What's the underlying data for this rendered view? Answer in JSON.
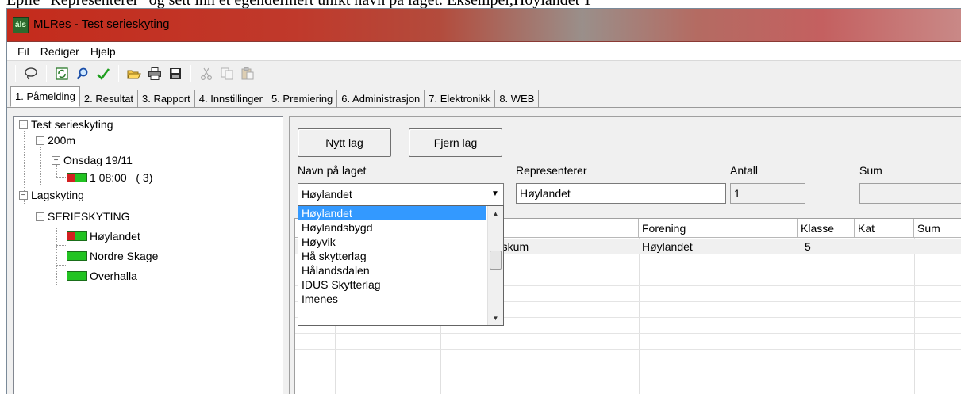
{
  "background_text": "Epile \"Representerer\" og sett inn et egendefinert unikt navn på laget. Eksempel,Hoylandet 1",
  "window": {
    "icon_text": "áls",
    "title": "MLRes - Test serieskyting"
  },
  "menu": [
    "Fil",
    "Rediger",
    "Hjelp"
  ],
  "toolbar": {
    "buttons": [
      "lasso-icon",
      "refresh-icon",
      "search-icon",
      "checkmark-icon",
      "open-folder-icon",
      "print-icon",
      "save-icon",
      "cut-icon",
      "copy-icon",
      "paste-icon"
    ]
  },
  "tabs": [
    "1. Påmelding",
    "2. Resultat",
    "3. Rapport",
    "4. Innstillinger",
    "5. Premiering",
    "6. Administrasjon",
    "7. Elektronikk",
    "8. WEB"
  ],
  "tree": {
    "root": "Test serieskyting",
    "distance": "200m",
    "day": "Onsdag 19/11",
    "relay": "1 08:00   ( 3)",
    "group": "Lagskyting",
    "series": "SERIESKYTING",
    "teams": [
      "Høylandet",
      "Nordre Skage",
      "Overhalla"
    ]
  },
  "panel": {
    "new_team_button": "Nytt lag",
    "remove_team_button": "Fjern lag",
    "team_name_label": "Navn på laget",
    "represents_label": "Representerer",
    "count_label": "Antall",
    "sum_label": "Sum",
    "team_name_value": "Høylandet",
    "represents_value": "Høylandet",
    "count_value": "1",
    "sum_value": ""
  },
  "dropdown_options": [
    "Høylandet",
    "Høylandsbygd",
    "Høyvik",
    "Hå skytterlag",
    "Hålandsdalen",
    "IDUS Skytterlag",
    "Imenes"
  ],
  "grid": {
    "columns": [
      "Forening",
      "Klasse",
      "Kat",
      "Sum"
    ],
    "rows": [
      {
        "name": "Fiskum",
        "forening": "Høylandet",
        "klasse": "5",
        "kat": "",
        "sum": ""
      }
    ]
  }
}
